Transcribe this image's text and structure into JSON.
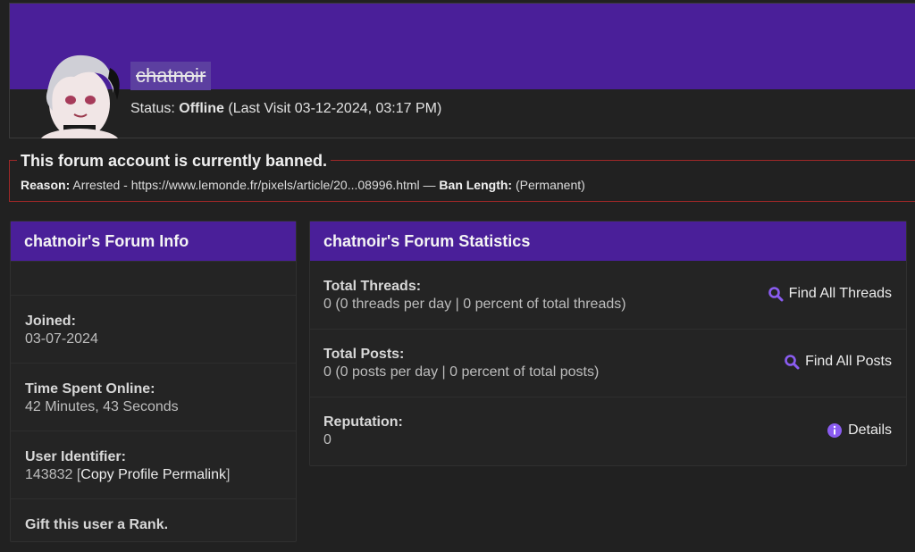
{
  "profile": {
    "username": "chatnoir",
    "status_prefix": "Status: ",
    "status_value": "Offline",
    "status_suffix": " (Last Visit 03-12-2024, 03:17 PM)"
  },
  "ban": {
    "title": "This forum account is currently banned.",
    "reason_label": "Reason:",
    "reason_text": "Arrested - https://www.lemonde.fr/pixels/article/20...08996.html — ",
    "length_label": "Ban Length:",
    "length_value": "(Permanent)"
  },
  "info_panel": {
    "title": "chatnoir's Forum Info",
    "joined_label": "Joined:",
    "joined_value": "03-07-2024",
    "online_label": "Time Spent Online:",
    "online_value": "42 Minutes, 43 Seconds",
    "uid_label": "User Identifier:",
    "uid_value": "143832",
    "uid_link_open": " [",
    "uid_link": "Copy Profile Permalink",
    "uid_link_close": "]",
    "gift_label": "Gift this user a Rank."
  },
  "stats_panel": {
    "title": "chatnoir's Forum Statistics",
    "threads_label": "Total Threads:",
    "threads_value": "0 (0 threads per day | 0 percent of total threads)",
    "threads_action": "Find All Threads",
    "posts_label": "Total Posts:",
    "posts_value": "0 (0 posts per day | 0 percent of total posts)",
    "posts_action": "Find All Posts",
    "rep_label": "Reputation:",
    "rep_value": "0",
    "rep_action": "Details"
  },
  "colors": {
    "accent": "#4a1f99",
    "icon": "#8a5cf0",
    "ban_border": "#a02828"
  },
  "icons": {
    "search": "search-icon",
    "info": "info-icon"
  }
}
